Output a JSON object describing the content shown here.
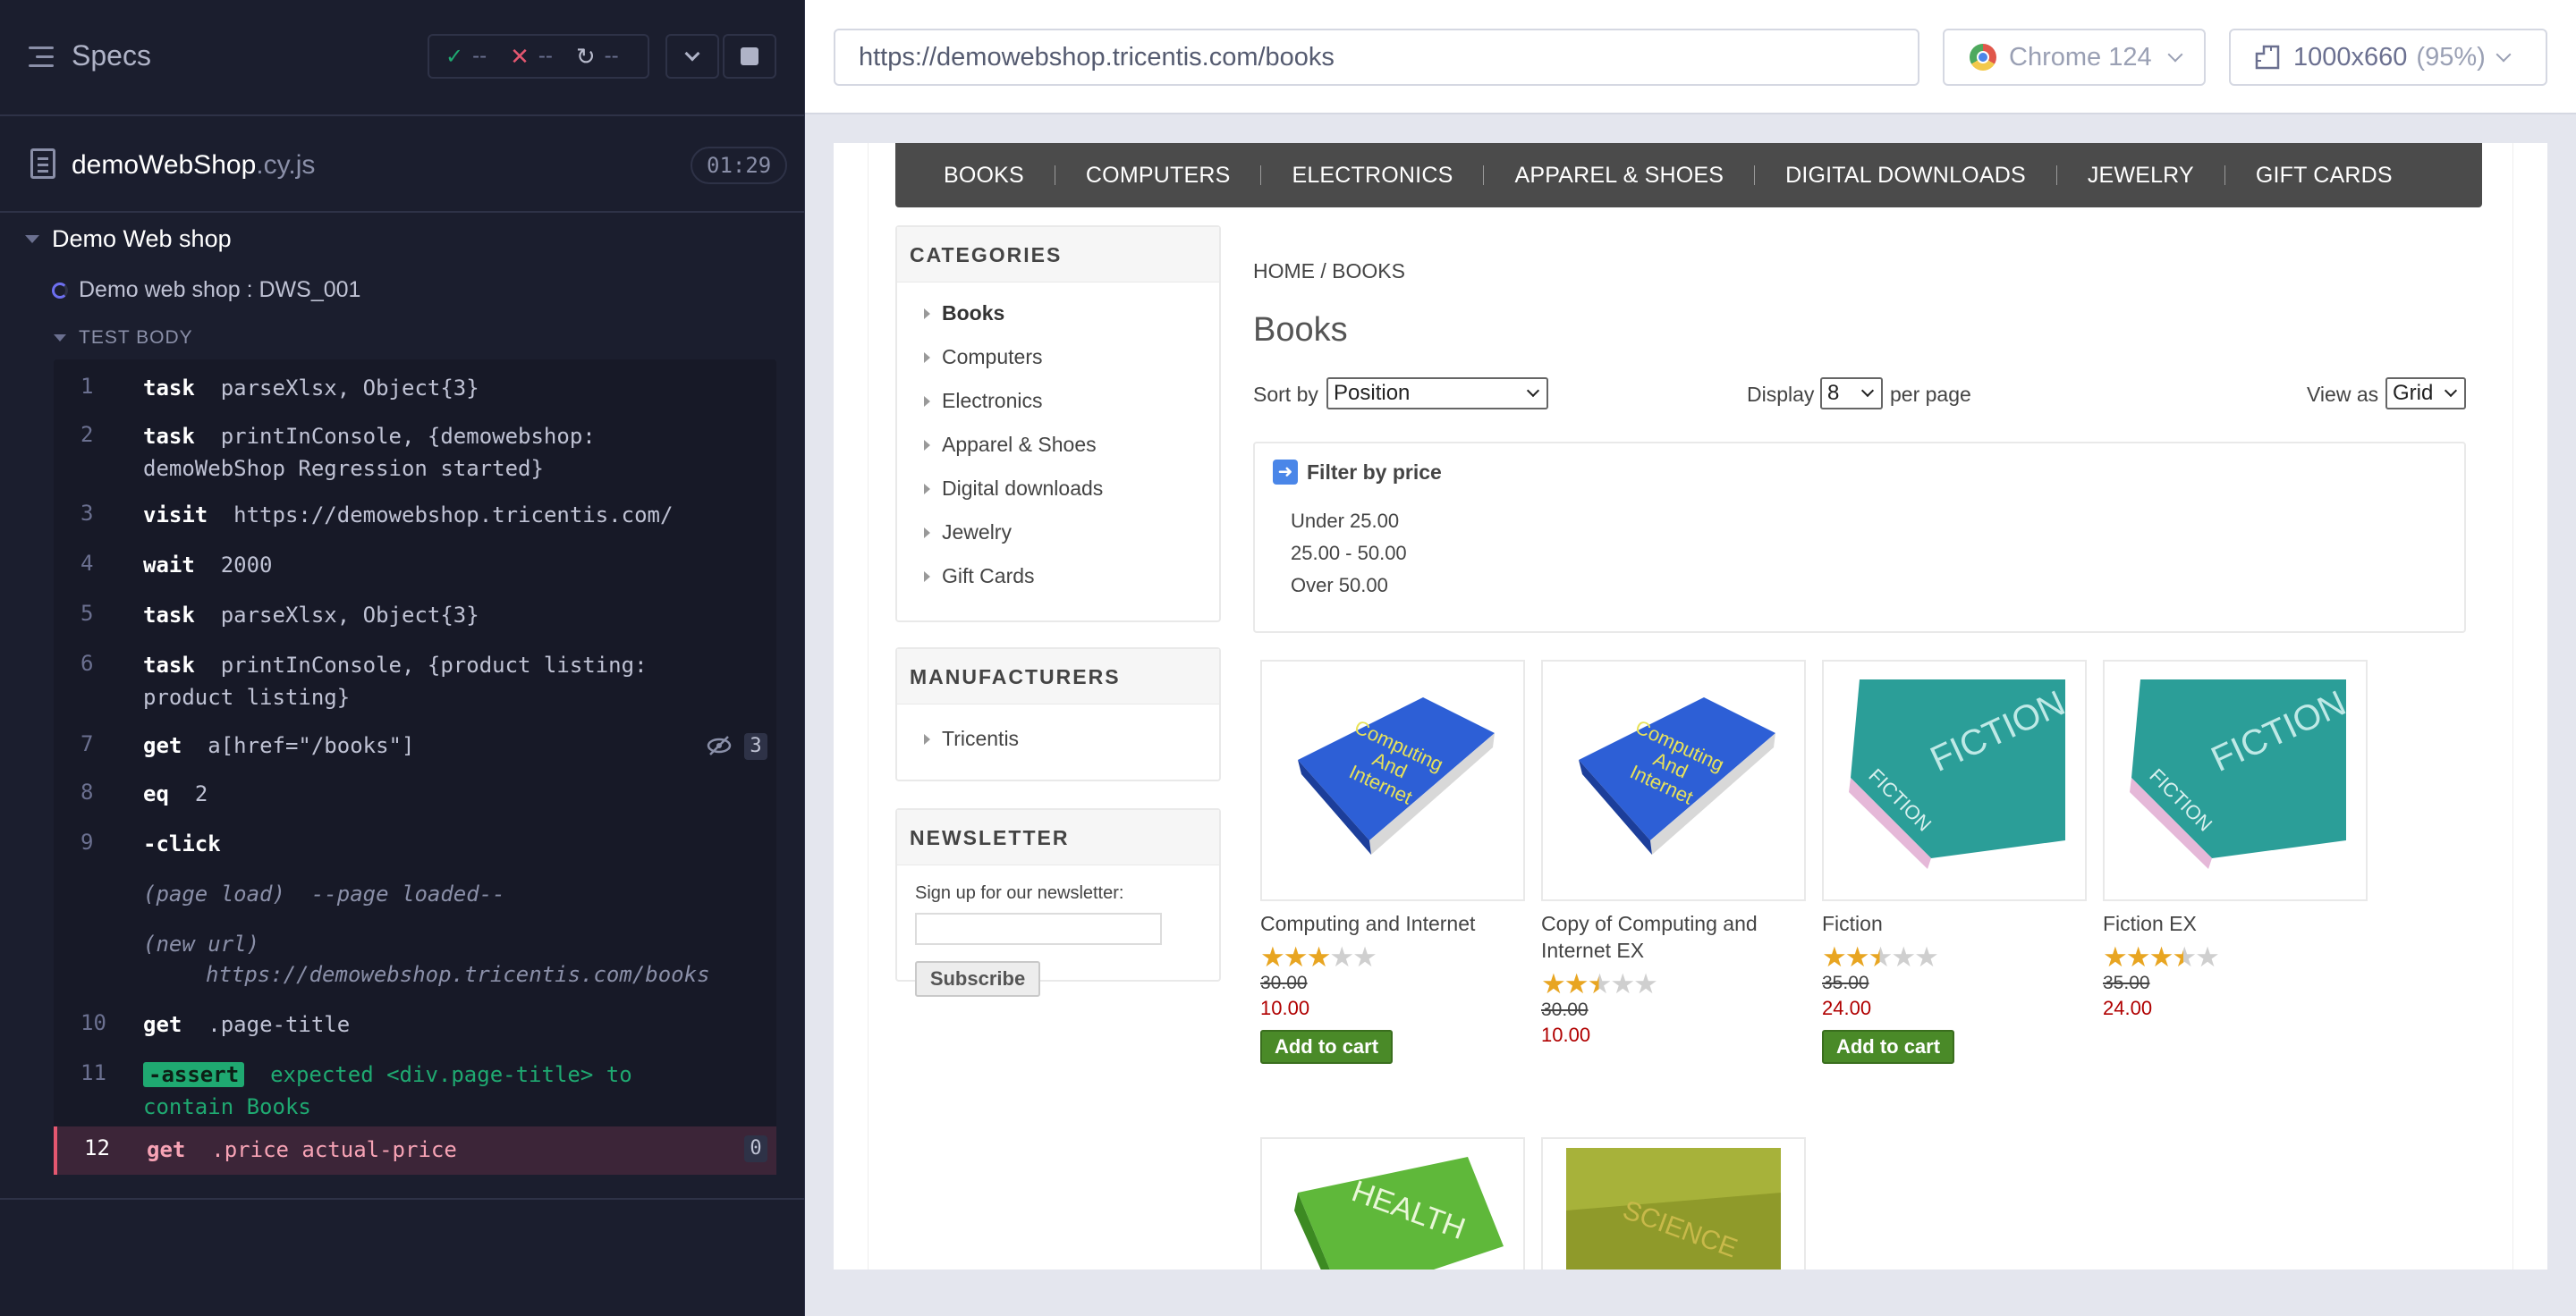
{
  "runner": {
    "specs_label": "Specs",
    "stats": {
      "passed": "--",
      "failed": "--",
      "pending": "--"
    },
    "spec_file": {
      "name": "demoWebShop",
      "ext": ".cy.js",
      "duration": "01:29"
    },
    "suite_title": "Demo Web shop",
    "test_title": "Demo web shop : DWS_001",
    "section_label": "TEST BODY",
    "commands": [
      {
        "num": "1",
        "kw": "task",
        "arg": "parseXlsx, Object{3}"
      },
      {
        "num": "2",
        "kw": "task",
        "arg": "printInConsole, {demowebshop: demoWebShop Regression started}"
      },
      {
        "num": "3",
        "kw": "visit",
        "arg": "https://demowebshop.tricentis.com/"
      },
      {
        "num": "4",
        "kw": "wait",
        "arg": "2000"
      },
      {
        "num": "5",
        "kw": "task",
        "arg": "parseXlsx, Object{3}"
      },
      {
        "num": "6",
        "kw": "task",
        "arg": "printInConsole, {product listing: product listing}"
      },
      {
        "num": "7",
        "kw": "get",
        "arg": "a[href=\"/books\"]",
        "count": "3"
      },
      {
        "num": "8",
        "kw": "eq",
        "arg": "2"
      },
      {
        "num": "9",
        "kw": "-click",
        "arg": ""
      },
      {
        "num": "",
        "kw": "(page load)",
        "arg": "--page loaded--"
      },
      {
        "num": "",
        "kw": "(new url)",
        "arg": "https://demowebshop.tricentis.com/books"
      },
      {
        "num": "10",
        "kw": "get",
        "arg": ".page-title"
      },
      {
        "num": "11",
        "kw": "-assert",
        "arg": "expected <div.page-title> to contain Books"
      },
      {
        "num": "12",
        "kw": "get",
        "arg": ".price actual-price",
        "count": "0"
      }
    ]
  },
  "browser": {
    "url": "https://demowebshop.tricentis.com/books",
    "browser_name": "Chrome 124",
    "viewport": "1000x660",
    "zoom": "(95%)"
  },
  "site": {
    "menu": [
      "BOOKS",
      "COMPUTERS",
      "ELECTRONICS",
      "APPAREL & SHOES",
      "DIGITAL DOWNLOADS",
      "JEWELRY",
      "GIFT CARDS"
    ],
    "categories_title": "CATEGORIES",
    "categories": [
      "Books",
      "Computers",
      "Electronics",
      "Apparel & Shoes",
      "Digital downloads",
      "Jewelry",
      "Gift Cards"
    ],
    "manufacturers_title": "MANUFACTURERS",
    "manufacturers": [
      "Tricentis"
    ],
    "newsletter_title": "NEWSLETTER",
    "newsletter_label": "Sign up for our newsletter:",
    "subscribe_label": "Subscribe",
    "breadcrumb_home": "HOME",
    "breadcrumb_sep": "/",
    "breadcrumb_current": "BOOKS",
    "page_title": "Books",
    "sort_label": "Sort by",
    "sort_value": "Position",
    "display_label": "Display",
    "display_value": "8",
    "per_page_label": "per page",
    "view_label": "View as",
    "view_value": "Grid",
    "filter_title": "Filter by price",
    "filter_options": [
      "Under 25.00",
      "25.00 - 50.00",
      "Over 50.00"
    ],
    "add_to_cart_label": "Add to cart",
    "products": [
      {
        "name": "Computing and Internet",
        "rating": 3,
        "old_price": "30.00",
        "price": "10.00",
        "cover": "blue",
        "cover_text": "Computing And Internet",
        "button": true
      },
      {
        "name": "Copy of Computing and Internet EX",
        "rating": 2.5,
        "old_price": "30.00",
        "price": "10.00",
        "cover": "blue",
        "cover_text": "Computing And Internet",
        "button": false
      },
      {
        "name": "Fiction",
        "rating": 2.5,
        "old_price": "35.00",
        "price": "24.00",
        "cover": "teal",
        "cover_text": "FICTION",
        "button": true
      },
      {
        "name": "Fiction EX",
        "rating": 3.5,
        "old_price": "35.00",
        "price": "24.00",
        "cover": "teal",
        "cover_text": "FICTION",
        "button": false
      },
      {
        "name": "",
        "cover": "green",
        "cover_text": "HEALTH"
      },
      {
        "name": "",
        "cover": "olive",
        "cover_text": "SCIENCE"
      }
    ],
    "colors": {
      "menu_bg": "#4b4b4b",
      "price_red": "#b00000",
      "cart_green": "#4a8a28",
      "star": "#e8a521"
    }
  }
}
